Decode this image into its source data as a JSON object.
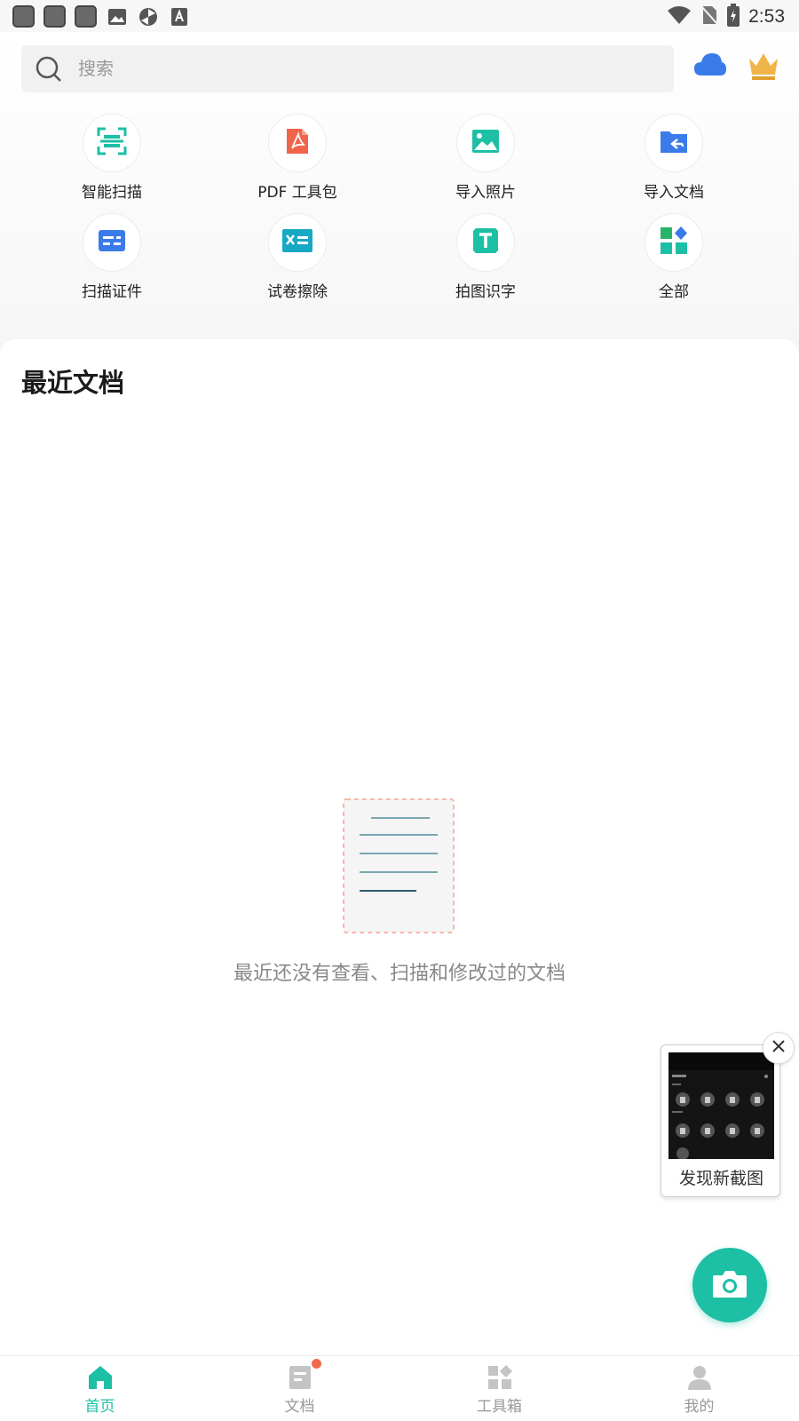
{
  "status_bar": {
    "time": "2:53",
    "left_icons": [
      "app-square-icon",
      "app-square-icon",
      "app-square-icon",
      "image-icon",
      "sync-icon",
      "font-icon"
    ],
    "right_icons": [
      "wifi-icon",
      "no-sim-icon",
      "battery-charging-icon"
    ]
  },
  "search": {
    "placeholder": "搜索"
  },
  "header_icons": [
    "cloud-icon",
    "crown-icon"
  ],
  "tools": [
    {
      "label": "智能扫描",
      "icon": "smart-scan-icon"
    },
    {
      "label": "PDF 工具包",
      "icon": "pdf-icon"
    },
    {
      "label": "导入照片",
      "icon": "import-photo-icon"
    },
    {
      "label": "导入文档",
      "icon": "import-document-icon"
    },
    {
      "label": "扫描证件",
      "icon": "id-card-icon"
    },
    {
      "label": "试卷擦除",
      "icon": "exam-erase-icon"
    },
    {
      "label": "拍图识字",
      "icon": "text-recognition-icon"
    },
    {
      "label": "全部",
      "icon": "all-tools-icon"
    }
  ],
  "recent": {
    "title": "最近文档",
    "empty_text": "最近还没有查看、扫描和修改过的文档"
  },
  "screenshot_popup": {
    "label": "发现新截图"
  },
  "bottom_nav": [
    {
      "label": "首页",
      "active": true
    },
    {
      "label": "文档",
      "active": false,
      "badge": true
    },
    {
      "label": "工具箱",
      "active": false
    },
    {
      "label": "我的",
      "active": false
    }
  ],
  "colors": {
    "accent": "#1dbfa5",
    "pdf_red": "#f2644a",
    "blue": "#3a7bea",
    "badge_red": "#f26a4b"
  }
}
